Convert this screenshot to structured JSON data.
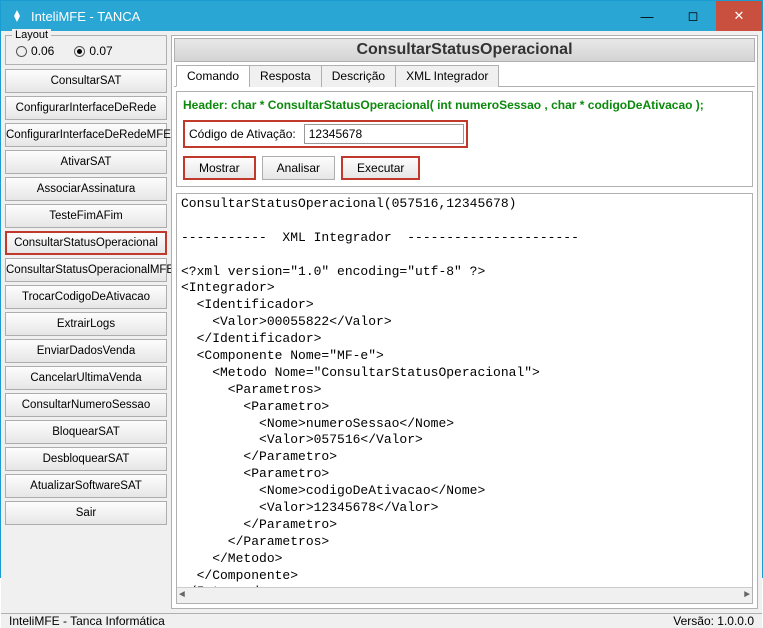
{
  "window": {
    "title": "InteliMFE - TANCA"
  },
  "layout": {
    "legend": "Layout",
    "options": [
      "0.06",
      "0.07"
    ],
    "selected": "0.07"
  },
  "sidebar": {
    "items": [
      "ConsultarSAT",
      "ConfigurarInterfaceDeRede",
      "ConfigurarInterfaceDeRedeMFE",
      "AtivarSAT",
      "AssociarAssinatura",
      "TesteFimAFim",
      "ConsultarStatusOperacional",
      "ConsultarStatusOperacionalMFE",
      "TrocarCodigoDeAtivacao",
      "ExtrairLogs",
      "EnviarDadosVenda",
      "CancelarUltimaVenda",
      "ConsultarNumeroSessao",
      "BloquearSAT",
      "DesbloquearSAT",
      "AtualizarSoftwareSAT",
      "Sair"
    ],
    "selected_index": 6
  },
  "main": {
    "title": "ConsultarStatusOperacional",
    "tabs": [
      "Comando",
      "Resposta",
      "Descrição",
      "XML Integrador"
    ],
    "active_tab": 0,
    "header_sig": "Header: char * ConsultarStatusOperacional( int numeroSessao , char * codigoDeAtivacao );",
    "field_label": "Código de Ativação:",
    "field_value": "12345678",
    "buttons": [
      "Mostrar",
      "Analisar",
      "Executar"
    ],
    "highlighted_buttons": [
      0,
      2
    ],
    "output": "ConsultarStatusOperacional(057516,12345678)\n\n-----------  XML Integrador  ----------------------\n\n<?xml version=\"1.0\" encoding=\"utf-8\" ?>\n<Integrador>\n  <Identificador>\n    <Valor>00055822</Valor>\n  </Identificador>\n  <Componente Nome=\"MF-e\">\n    <Metodo Nome=\"ConsultarStatusOperacional\">\n      <Parametros>\n        <Parametro>\n          <Nome>numeroSessao</Nome>\n          <Valor>057516</Valor>\n        </Parametro>\n        <Parametro>\n          <Nome>codigoDeAtivacao</Nome>\n          <Valor>12345678</Valor>\n        </Parametro>\n      </Parametros>\n    </Metodo>\n  </Componente>\n</Integrador>"
  },
  "statusbar": {
    "left": "InteliMFE - Tanca Informática",
    "right": "Versão: 1.0.0.0"
  }
}
